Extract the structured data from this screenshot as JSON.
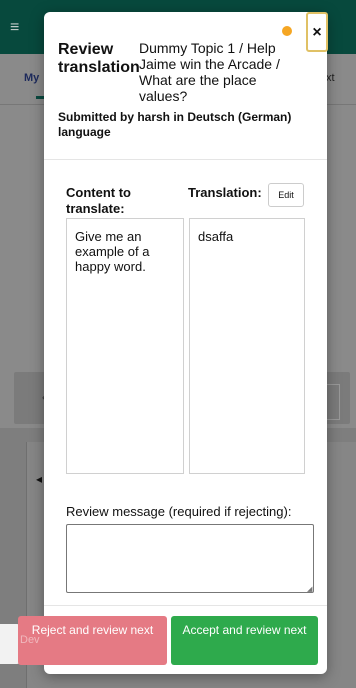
{
  "background": {
    "tab_left": "My",
    "tab_right": "xt",
    "hidden_button_text": "Dev"
  },
  "modal": {
    "title": "Review translation",
    "topic": "Dummy Topic 1 / Help Jaime win the Arcade / What are the place values?",
    "submitted": "Submitted by harsh in Deutsch (German) language",
    "close_label": "×",
    "content_label": "Content to translate:",
    "translation_label": "Translation:",
    "edit_label": "Edit",
    "content_text": "Give me an example of a happy word.",
    "translation_text": "dsaffa",
    "review_label": "Review message (required if rejecting):",
    "review_value": "",
    "reject_label": "Reject and review next",
    "accept_label": "Accept and review next"
  },
  "colors": {
    "header": "#07493d",
    "reject": "#e57a84",
    "accept": "#2eaa4c",
    "close_border": "#e0c165"
  }
}
